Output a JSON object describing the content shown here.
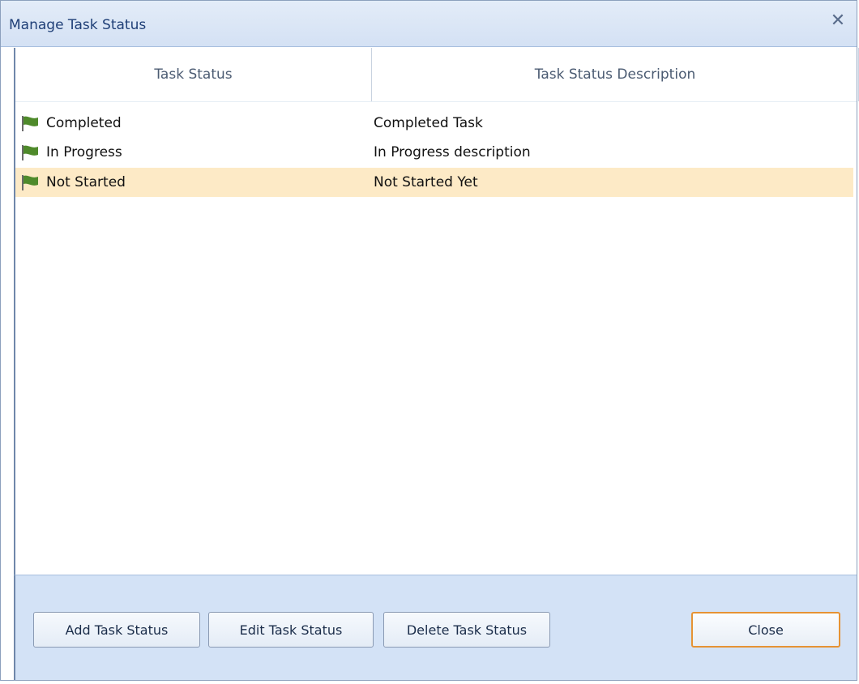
{
  "window": {
    "title": "Manage Task Status",
    "close_glyph": "✕"
  },
  "grid": {
    "columns": [
      {
        "label": "Task Status"
      },
      {
        "label": "Task Status Description"
      }
    ],
    "rows": [
      {
        "status": "Completed",
        "description": "Completed Task",
        "icon": "green-flag-icon",
        "selected": false
      },
      {
        "status": "In Progress",
        "description": "In Progress description",
        "icon": "green-flag-icon",
        "selected": false
      },
      {
        "status": "Not Started",
        "description": "Not Started Yet",
        "icon": "green-flag-icon",
        "selected": true
      }
    ]
  },
  "buttons": {
    "add": "Add Task Status",
    "edit": "Edit Task Status",
    "delete": "Delete Task Status",
    "close": "Close"
  },
  "colors": {
    "selected_row": "#fdeac6",
    "footer": "#d3e2f6",
    "title_text": "#1f3f77",
    "flag_green": "#4f8a2b",
    "close_button_border": "#e69334"
  }
}
